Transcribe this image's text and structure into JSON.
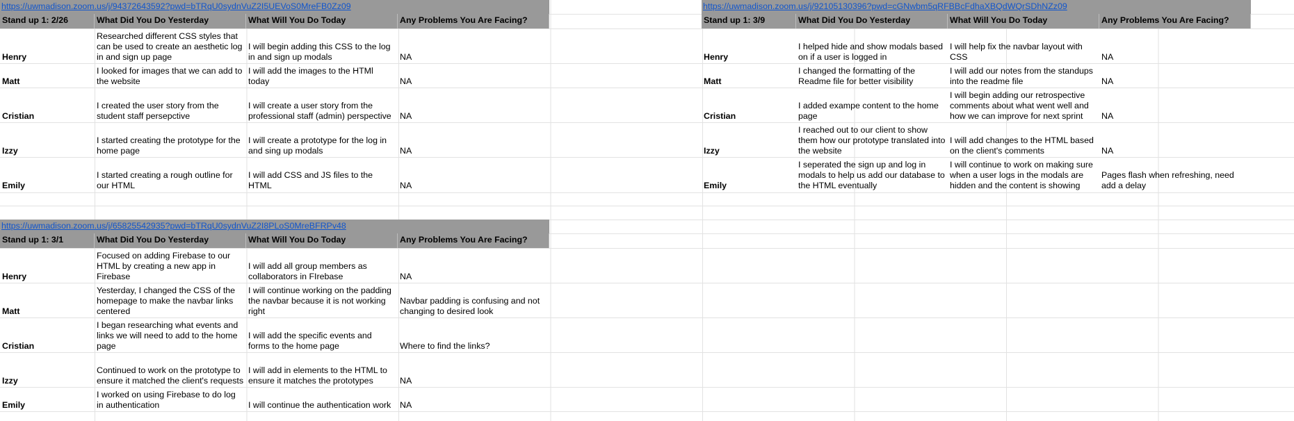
{
  "tables": [
    {
      "link": "https://uwmadison.zoom.us/j/94372643592?pwd=bTRqU0sydnVuZ2I5UEVoS0MreFB0Zz09",
      "headers": [
        "Stand up 1: 2/26",
        "What Did You Do Yesterday",
        "What Will You Do Today",
        "Any Problems You Are Facing?"
      ],
      "rows": [
        {
          "name": "Henry",
          "yesterday": "Researched different CSS styles that can be used to create an aesthetic log in and sign up page",
          "today": "I will begin adding this CSS to the log in and sign up modals",
          "problems": "NA"
        },
        {
          "name": "Matt",
          "yesterday": "I looked for images that we can add to the website",
          "today": "I will add the images to the HTMl today",
          "problems": "NA"
        },
        {
          "name": "Cristian",
          "yesterday": "I created the user story from the student staff persepctive",
          "today": "I will create a user story from the professional staff (admin) perspective",
          "problems": "NA"
        },
        {
          "name": "Izzy",
          "yesterday": "I started creating the prototype for the home page",
          "today": "I will create a prototype for the log in and sing up modals",
          "problems": "NA"
        },
        {
          "name": "Emily",
          "yesterday": "I started creating a rough outline for our HTML",
          "today": "I will add CSS and JS files to the HTML",
          "problems": "NA"
        }
      ]
    },
    {
      "link": "https://uwmadison.zoom.us/j/92105130396?pwd=cGNwbm5qRFBBcFdhaXBQdWQrSDhNZz09",
      "headers": [
        "Stand up 1: 3/9",
        "What Did You Do Yesterday",
        "What Will You Do Today",
        "Any Problems You Are Facing?"
      ],
      "rows": [
        {
          "name": "Henry",
          "yesterday": "I helped hide and show modals based on if a user is logged in",
          "today": "I will help fix the navbar layout with CSS",
          "problems": "NA"
        },
        {
          "name": "Matt",
          "yesterday": "I changed the formatting of the Readme file for better visibility",
          "today": "I will add our notes from the standups into the readme file",
          "problems": "NA"
        },
        {
          "name": "Cristian",
          "yesterday": "I added exampe content to the home page",
          "today": "I will begin adding our retrospective comments about what went well and how we can improve for next sprint",
          "problems": "NA"
        },
        {
          "name": "Izzy",
          "yesterday": "I reached out to our client to show them how our prototype translated into the website",
          "today": "I will add changes to the HTML based on the client's comments",
          "problems": "NA"
        },
        {
          "name": "Emily",
          "yesterday": "I seperated the sign up and log in modals to help us add our database to the HTML eventually",
          "today": "I will continue to work on making sure when a user logs in the modals are hidden and the content is showing",
          "problems": "Pages flash when refreshing, need add a delay"
        }
      ]
    },
    {
      "link": "https://uwmadison.zoom.us/j/65825542935?pwd=bTRqU0sydnVuZ2I8PLoS0MreBFRPv48",
      "headers": [
        "Stand up 1: 3/1",
        "What Did You Do Yesterday",
        "What Will You Do Today",
        "Any Problems You Are Facing?"
      ],
      "rows": [
        {
          "name": "Henry",
          "yesterday": "Focused on adding Firebase to our HTML by creating a new app in Firebase",
          "today": "I will add all group members as collaborators in FIrebase",
          "problems": "NA"
        },
        {
          "name": "Matt",
          "yesterday": "Yesterday, I changed the CSS of the homepage to make the navbar links centered",
          "today": "I will continue working on the padding the navbar because it is not working right",
          "problems": "Navbar padding is confusing and not changing to desired look"
        },
        {
          "name": "Cristian",
          "yesterday": "I began researching what events and links we will need to add to the home page",
          "today": "I will add the specific events and forms to the home page",
          "problems": "Where to find the links?"
        },
        {
          "name": "Izzy",
          "yesterday": "Continued to work on the prototype to ensure it matched the client's requests",
          "today": "I will add in elements to the HTML to ensure it matches the prototypes",
          "problems": "NA"
        },
        {
          "name": "Emily",
          "yesterday": "I worked on using Firebase to do log in authentication",
          "today": "I will continue the authentication work",
          "problems": "NA"
        }
      ]
    }
  ]
}
